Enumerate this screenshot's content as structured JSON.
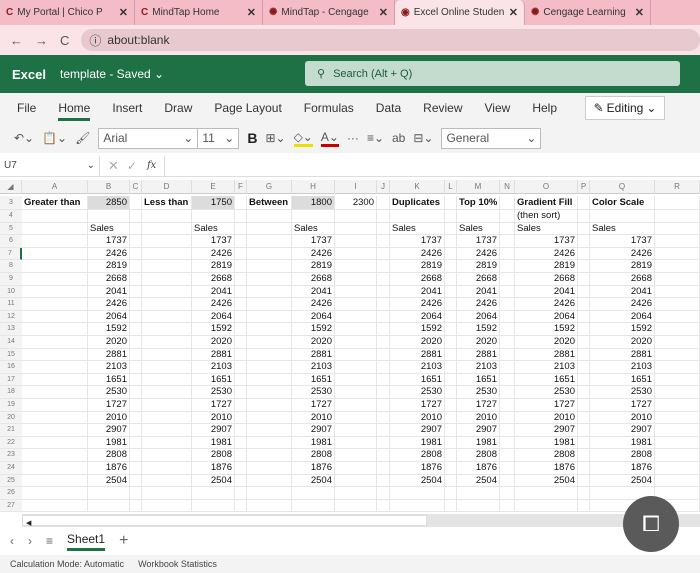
{
  "browser": {
    "tabs": [
      {
        "label": "My Portal | Chico P",
        "icon": "C"
      },
      {
        "label": "MindTap Home",
        "icon": "C"
      },
      {
        "label": "MindTap - Cengage",
        "icon": "✺"
      },
      {
        "label": "Excel Online Studen",
        "icon": "◉"
      },
      {
        "label": "Cengage Learning",
        "icon": "✺"
      }
    ],
    "address": "about:blank"
  },
  "app": {
    "brand": "Excel",
    "doc": "template - Saved ⌄",
    "search": "Search (Alt + Q)"
  },
  "menu": {
    "items": [
      "File",
      "Home",
      "Insert",
      "Draw",
      "Page Layout",
      "Formulas",
      "Data",
      "Review",
      "View",
      "Help"
    ],
    "editing": "Editing"
  },
  "toolbar": {
    "font": "Arial",
    "size": "11",
    "bold": "B",
    "number_format": "General"
  },
  "formula": {
    "cell": "U7",
    "fx": "fx"
  },
  "columns": [
    "A",
    "B",
    "C",
    "D",
    "E",
    "F",
    "G",
    "H",
    "I",
    "J",
    "K",
    "L",
    "M",
    "N",
    "O",
    "P",
    "Q",
    "R"
  ],
  "row3": {
    "A": "Greater than",
    "B": "2850",
    "D": "Less than",
    "E": "1750",
    "G": "Between",
    "H": "1800",
    "I": "2300",
    "K": "Duplicates",
    "M": "Top 10%",
    "O": "Gradient Fill",
    "Q": "Color Scale"
  },
  "row4": {
    "O": "(then sort)"
  },
  "row5": {
    "B": "Sales",
    "E": "Sales",
    "H": "Sales",
    "K": "Sales",
    "M": "Sales",
    "O": "Sales",
    "Q": "Sales"
  },
  "sales": [
    1737,
    2426,
    2819,
    2668,
    2041,
    2426,
    2064,
    1592,
    2020,
    2881,
    2103,
    1651,
    2530,
    1727,
    2010,
    2907,
    1981,
    2808,
    1876,
    2504
  ],
  "sheets": {
    "active": "Sheet1"
  },
  "status": {
    "calc": "Calculation Mode: Automatic",
    "stats": "Workbook Statistics"
  }
}
